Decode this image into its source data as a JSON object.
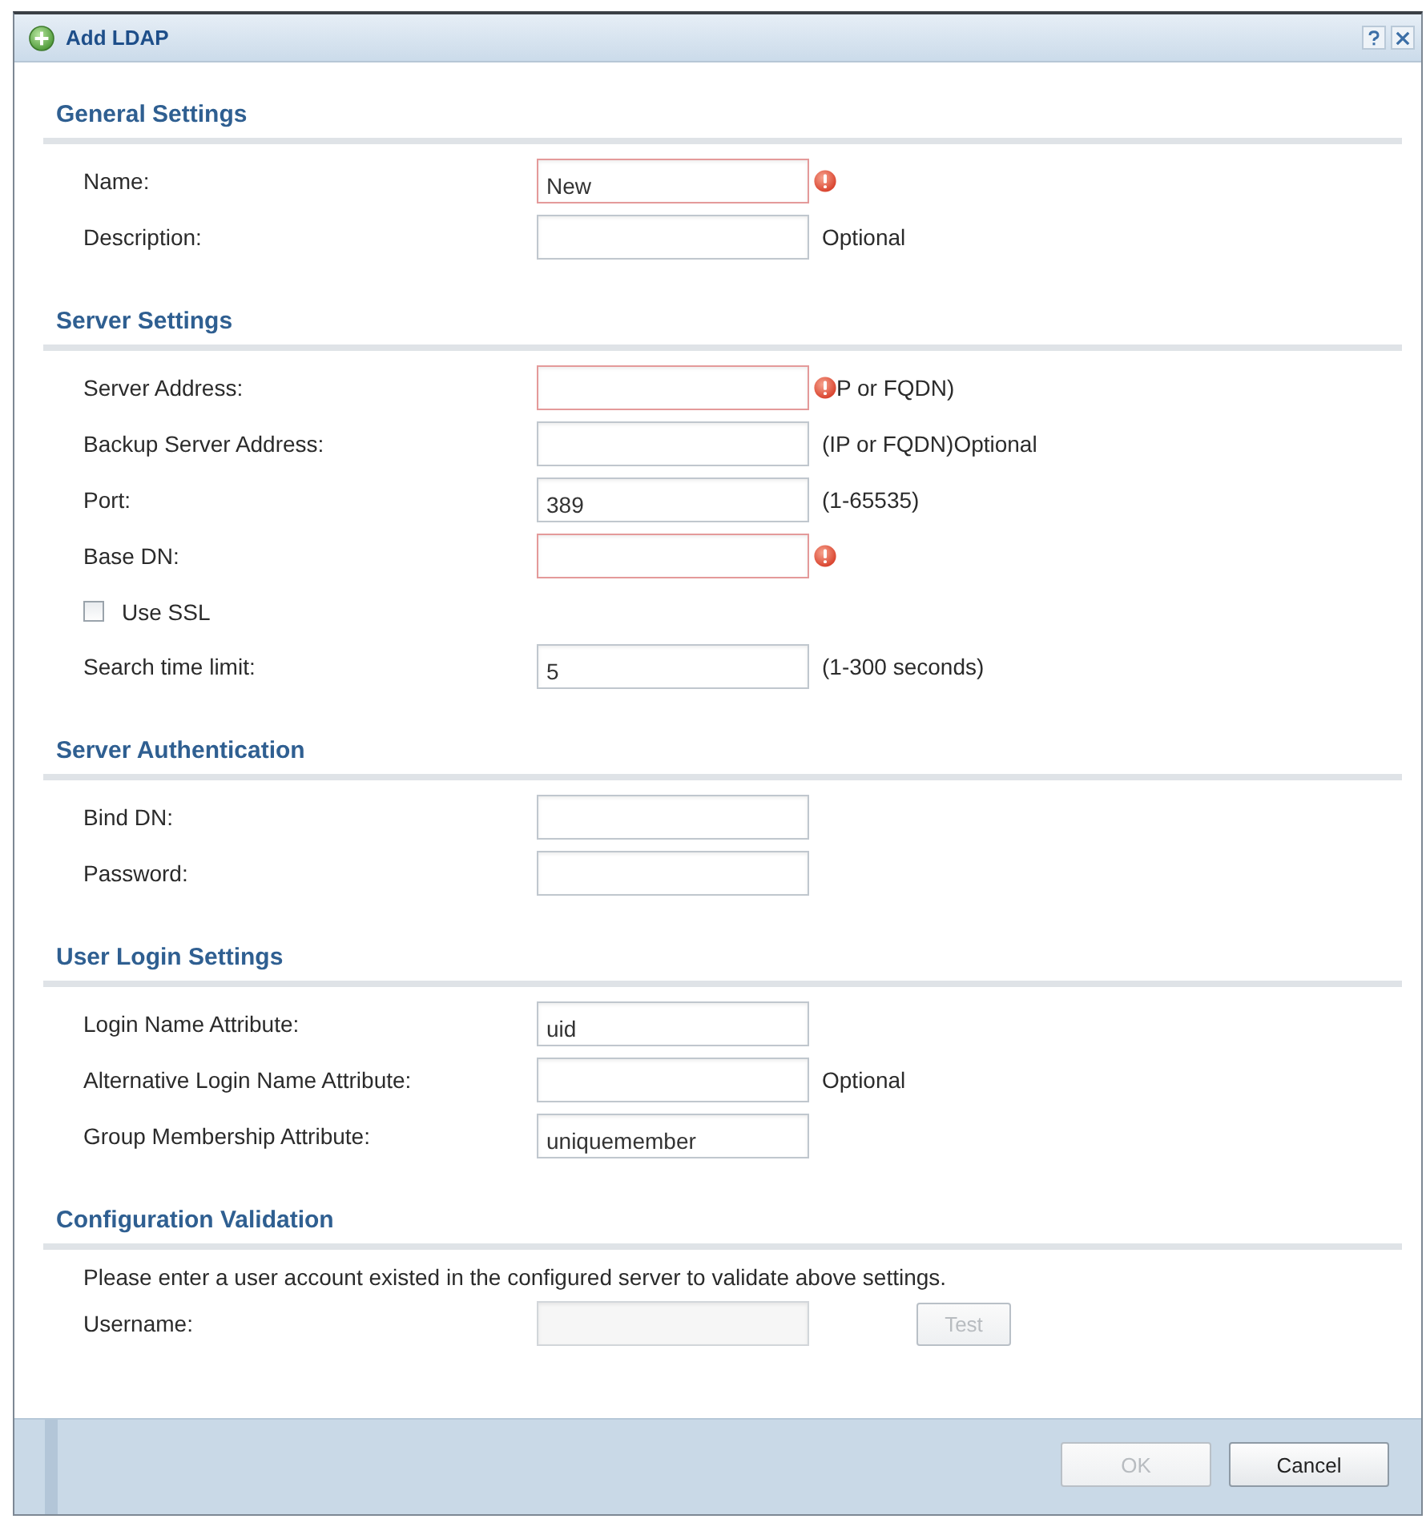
{
  "window": {
    "title": "Add LDAP"
  },
  "sections": [
    {
      "title": "General Settings",
      "rows": [
        {
          "kind": "field",
          "label": "Name:",
          "value": "New",
          "invalid": true,
          "disabled": false
        },
        {
          "kind": "field",
          "label": "Description:",
          "hint": "Optional",
          "invalid": false,
          "disabled": false
        }
      ]
    },
    {
      "title": "Server Settings",
      "rows": [
        {
          "kind": "field",
          "label": "Server Address:",
          "hint": "P or FQDN)",
          "invalid": true,
          "disabled": false
        },
        {
          "kind": "field",
          "label": "Backup Server Address:",
          "hint": "(IP or FQDN)Optional",
          "invalid": false,
          "disabled": false
        },
        {
          "kind": "field",
          "label": "Port:",
          "value": "389",
          "hint": "(1-65535)",
          "invalid": false,
          "disabled": false
        },
        {
          "kind": "field",
          "label": "Base DN:",
          "invalid": true,
          "disabled": false
        },
        {
          "kind": "checkbox",
          "label": "Use SSL",
          "checked": false
        },
        {
          "kind": "field",
          "label": "Search time limit:",
          "value": "5",
          "hint": "(1-300 seconds)",
          "invalid": false,
          "disabled": false
        }
      ]
    },
    {
      "title": "Server Authentication",
      "rows": [
        {
          "kind": "field",
          "label": "Bind DN:",
          "invalid": false,
          "disabled": false
        },
        {
          "kind": "field",
          "label": "Password:",
          "invalid": false,
          "disabled": false
        }
      ]
    },
    {
      "title": "User Login Settings",
      "rows": [
        {
          "kind": "field",
          "label": "Login Name Attribute:",
          "value": "uid",
          "invalid": false,
          "disabled": false
        },
        {
          "kind": "field",
          "label": "Alternative Login Name Attribute:",
          "hint": "Optional",
          "invalid": false,
          "disabled": false
        },
        {
          "kind": "field",
          "label": "Group Membership Attribute:",
          "value": "uniquemember",
          "invalid": false,
          "disabled": false
        }
      ]
    },
    {
      "title": "Configuration Validation",
      "rows": [
        {
          "kind": "note",
          "text": "Please enter a user account existed in the configured server to validate above settings."
        },
        {
          "kind": "field",
          "label": "Username:",
          "invalid": false,
          "disabled": true,
          "button": {
            "label": "Test",
            "disabled": true
          }
        }
      ]
    }
  ],
  "buttons": [
    {
      "label": "OK",
      "disabled": true
    },
    {
      "label": "Cancel",
      "disabled": false
    }
  ]
}
